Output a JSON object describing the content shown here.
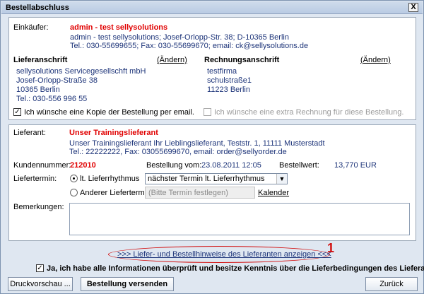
{
  "window": {
    "title": "Bestellabschluss",
    "close_label": "X"
  },
  "buyer": {
    "label": "Einkäufer:",
    "name": "admin - test sellysolutions",
    "address": "admin - test sellysolutions; Josef-Orlopp-Str. 38; D-10365 Berlin",
    "contact": "Tel.: 030-55699655; Fax: 030-55699670; email: ck@sellysolutions.de"
  },
  "delivery_address": {
    "heading": "Lieferanschrift",
    "change_label": "(Ändern)",
    "lines": [
      "sellysolutions Servicegesellschft mbH",
      "Josef-Orlopp-Straße 38",
      "10365 Berlin",
      "Tel.: 030-556 996 55"
    ]
  },
  "billing_address": {
    "heading": "Rechnungsanschrift",
    "change_label": "(Ändern)",
    "lines": [
      "testfirma",
      "schulstraße1",
      "11223 Berlin"
    ]
  },
  "options": {
    "copy_email": {
      "label": "Ich wünsche eine Kopie der Bestellung per email.",
      "checked": true
    },
    "extra_invoice": {
      "label": "Ich wünsche eine extra Rechnung für diese Bestellung.",
      "checked": false
    }
  },
  "supplier": {
    "label": "Lieferant:",
    "name": "Unser Trainingslieferant",
    "address": "Unser Trainingslieferant Ihr Lieblingslieferant, Teststr. 1, 11111 Musterstadt",
    "contact": "Tel.: 22222222, Fax: 03055699670, email: order@sellyorder.de"
  },
  "order": {
    "customer_no_label": "Kundennummer:",
    "customer_no": "212010",
    "order_date_label": "Bestellung vom:",
    "order_date": "23.08.2011 12:05",
    "order_value_label": "Bestellwert:",
    "order_value": "13,770 EUR"
  },
  "delivery_date": {
    "label": "Liefertermin:",
    "rhythm_label": "lt. Lieferrhythmus",
    "rhythm_selected": true,
    "rhythm_select_value": "nächster Termin lt. Lieferrhythmus",
    "other_label": "Anderer Liefertermin",
    "other_placeholder": "(Bitte Termin festlegen)",
    "calendar_label": "Kalender"
  },
  "remarks": {
    "label": "Bemerkungen:",
    "value": ""
  },
  "footer": {
    "supplier_info_link": ">>> Liefer- und Bestellhinweise des Lieferanten anzeigen <<<",
    "annotation_number": "1",
    "confirm_label": "Ja, ich habe alle Informationen überprüft und besitze Kenntnis über die Lieferbedingungen des Lieferanten.",
    "confirm_checked": true,
    "print_preview_label": "Druckvorschau ...",
    "send_order_label": "Bestellung versenden",
    "back_label": "Zurück"
  },
  "colors": {
    "accent_red": "#e00000",
    "text_blue": "#1d3479",
    "window_bg": "#dfe7f1"
  }
}
